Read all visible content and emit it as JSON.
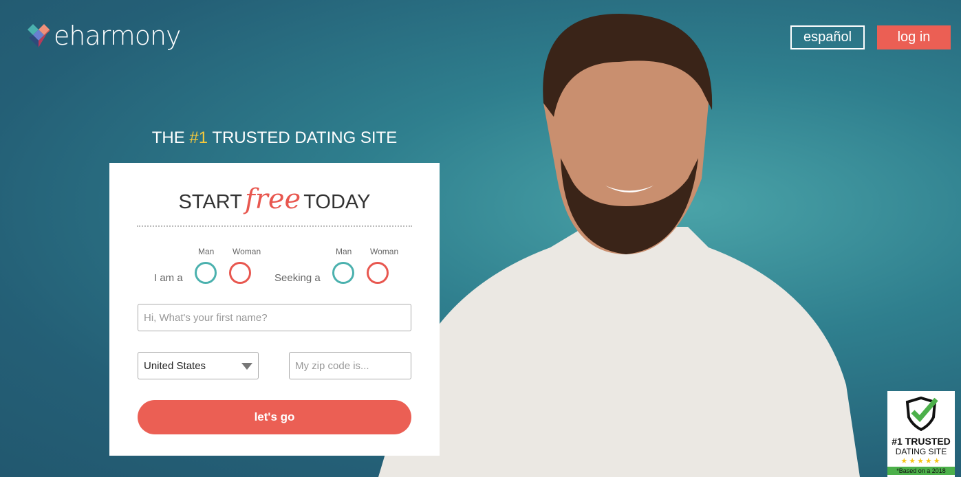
{
  "header": {
    "logo_text": "eharmony",
    "espanol_label": "español",
    "login_label": "log in"
  },
  "tagline": {
    "pre": "THE ",
    "highlight": "#1",
    "post": " TRUSTED DATING SITE"
  },
  "form": {
    "title_start": "START",
    "title_free": "free",
    "title_end": "TODAY",
    "i_am_label": "I am a",
    "seeking_label": "Seeking a",
    "man_label": "Man",
    "woman_label": "Woman",
    "first_name_placeholder": "Hi, What's your first name?",
    "country_value": "United States",
    "zip_placeholder": "My zip code is...",
    "submit_label": "let's go"
  },
  "badge": {
    "line1": "#1 TRUSTED",
    "line2": "DATING SITE",
    "stars": "★★★★★",
    "footnote": "*Based on a 2018"
  },
  "colors": {
    "accent": "#eb5f54",
    "teal": "#4bb1ae",
    "highlight": "#f5c93b",
    "background": "#245f76"
  }
}
